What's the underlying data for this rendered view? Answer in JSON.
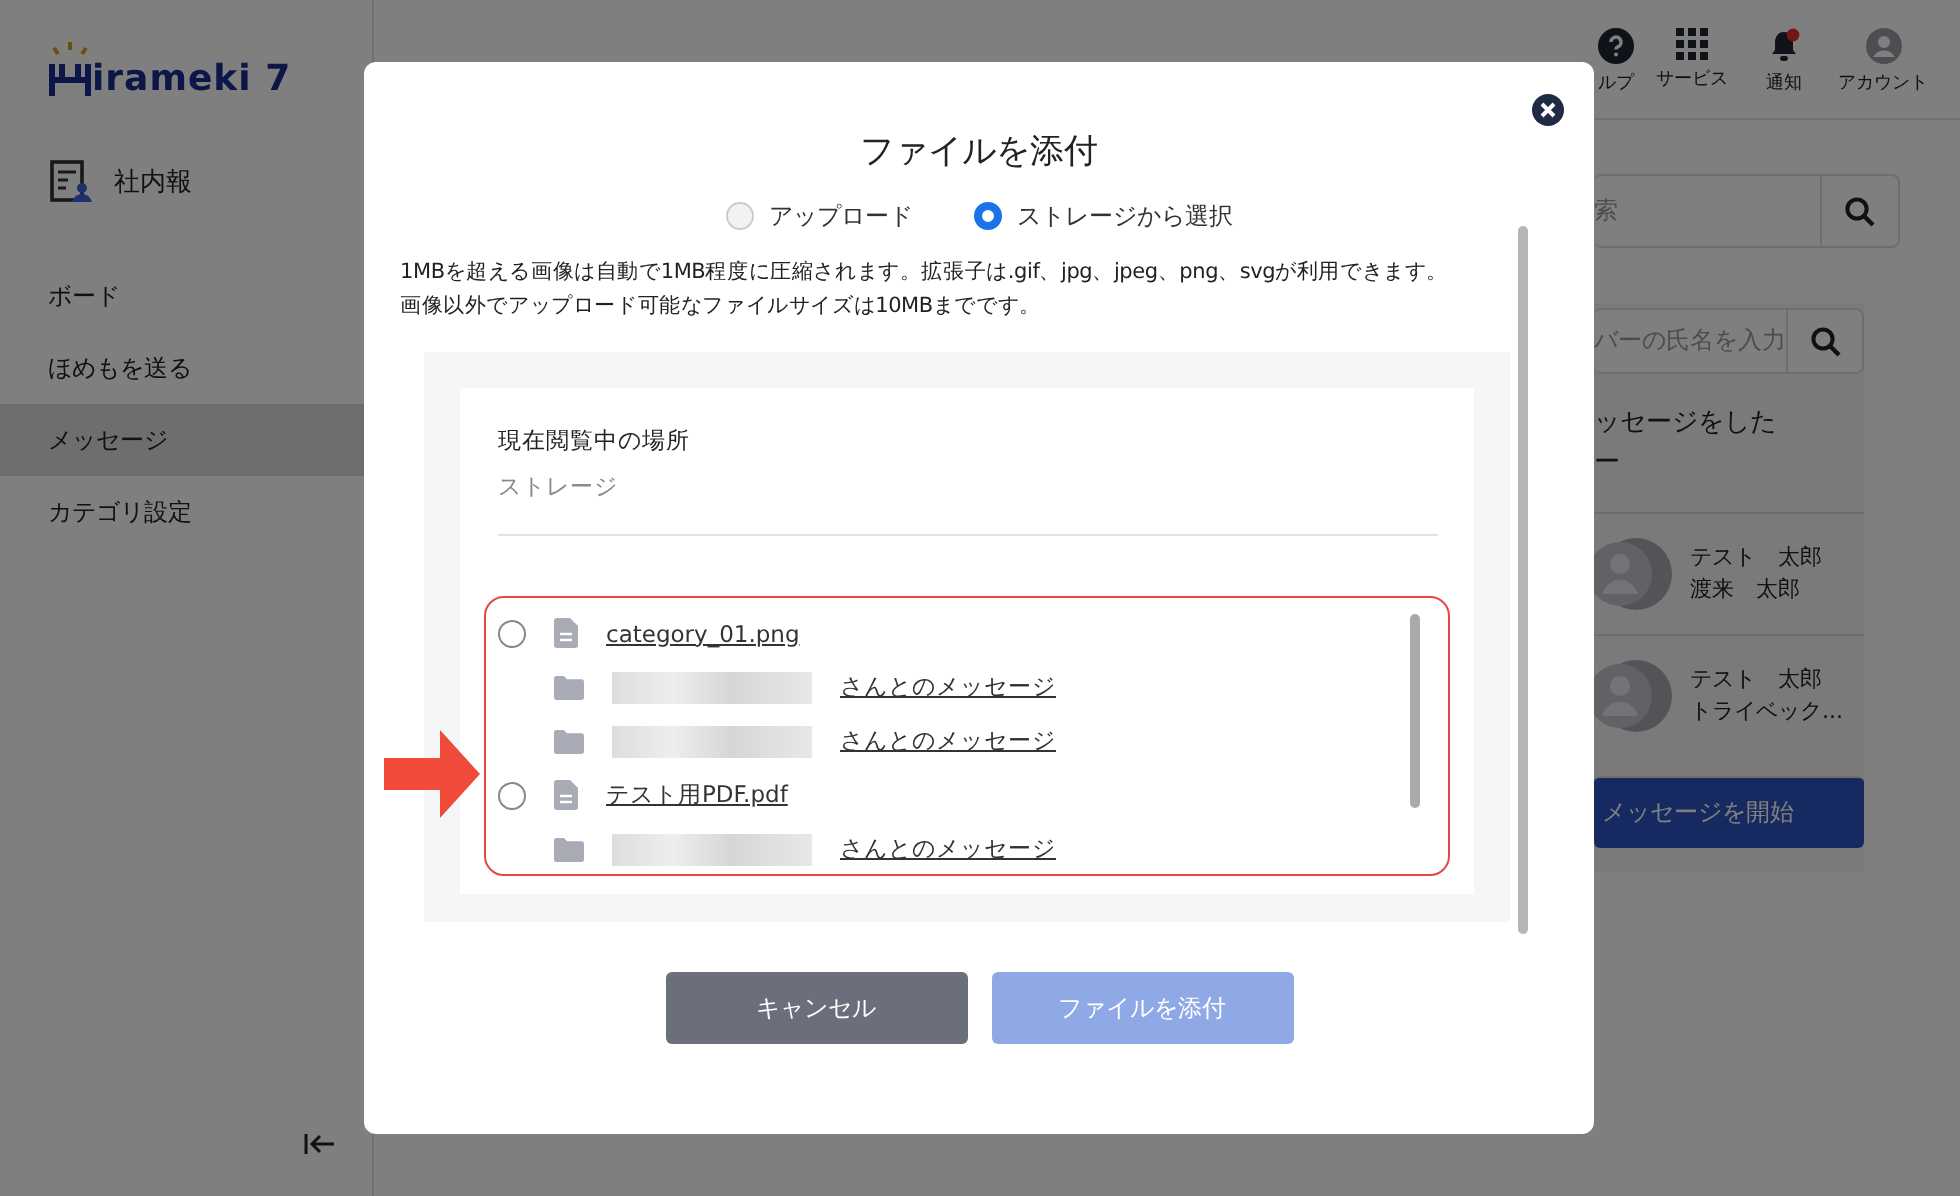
{
  "sidebar": {
    "logo_text": "irameki 7",
    "section": "社内報",
    "items": [
      {
        "label": "ボード",
        "selected": false
      },
      {
        "label": "ほめもを送る",
        "selected": false
      },
      {
        "label": "メッセージ",
        "selected": true
      },
      {
        "label": "カテゴリ設定",
        "selected": false
      }
    ]
  },
  "header": {
    "items": [
      {
        "kind": "help",
        "label": "ルプ"
      },
      {
        "kind": "services",
        "label": "サービス"
      },
      {
        "kind": "notifications",
        "label": "通知",
        "alert": true
      },
      {
        "kind": "account",
        "label": "アカウント"
      }
    ]
  },
  "right_panel": {
    "search": {
      "placeholder": "索"
    },
    "member_search": {
      "placeholder": "バーの氏名を入力"
    },
    "heading": [
      "ッセージをした",
      "ー"
    ],
    "groups": [
      {
        "names": [
          "テスト　太郎",
          "渡来　太郎"
        ]
      },
      {
        "names": [
          "テスト　太郎",
          "トライベック..."
        ]
      }
    ],
    "start_button": "メッセージを開始"
  },
  "dialog": {
    "title": "ファイルを添付",
    "sources": [
      {
        "label": "アップロード",
        "selected": false
      },
      {
        "label": "ストレージから選択",
        "selected": true
      }
    ],
    "notes": [
      "1MBを超える画像は自動で1MB程度に圧縮されます。拡張子は.gif、jpg、jpeg、png、svgが利用できます。",
      "画像以外でアップロード可能なファイルサイズは10MBまでです。"
    ],
    "location_label": "現在閲覧中の場所",
    "location": "ストレージ",
    "entries": [
      {
        "kind": "file",
        "name": "category_01.png",
        "selected": false
      },
      {
        "kind": "folder",
        "name": "さんとのメッセージ"
      },
      {
        "kind": "folder",
        "name": "さんとのメッセージ"
      },
      {
        "kind": "file",
        "name": "テスト用PDF.pdf",
        "selected": false
      },
      {
        "kind": "folder",
        "name": "さんとのメッセージ"
      }
    ],
    "buttons": [
      {
        "label": "キャンセル",
        "kind": "secondary",
        "disabled": false
      },
      {
        "label": "ファイルを添付",
        "kind": "primary",
        "disabled": true
      }
    ]
  }
}
